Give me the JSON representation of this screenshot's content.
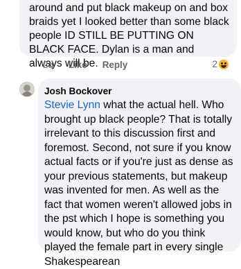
{
  "previous_comment": {
    "text": "around and put black makeup on and box braids yet I looked better than some black people ID STILL BE PUTTING ON BLACK FACE. Dylan is a man and always will be.",
    "timestamp": "2d",
    "like_label": "Like",
    "reply_label": "Reply",
    "reaction_count": "2",
    "reaction_icon": "laugh-emoji-icon"
  },
  "comment": {
    "author": "Josh Bockover",
    "mention": "Stevie Lynn",
    "text": " what the actual hell. Who brought up black people? That is totally irrelevant to this discussion first and foremost. Second, not sure if you know actual facts or if you're just as dense as your previous statements, but makeup was invented for men. As well as the fact that women weren't allowed jobs in the pst which I hope is something you would know, but who do you think played the female part in every single Shakespearean"
  }
}
